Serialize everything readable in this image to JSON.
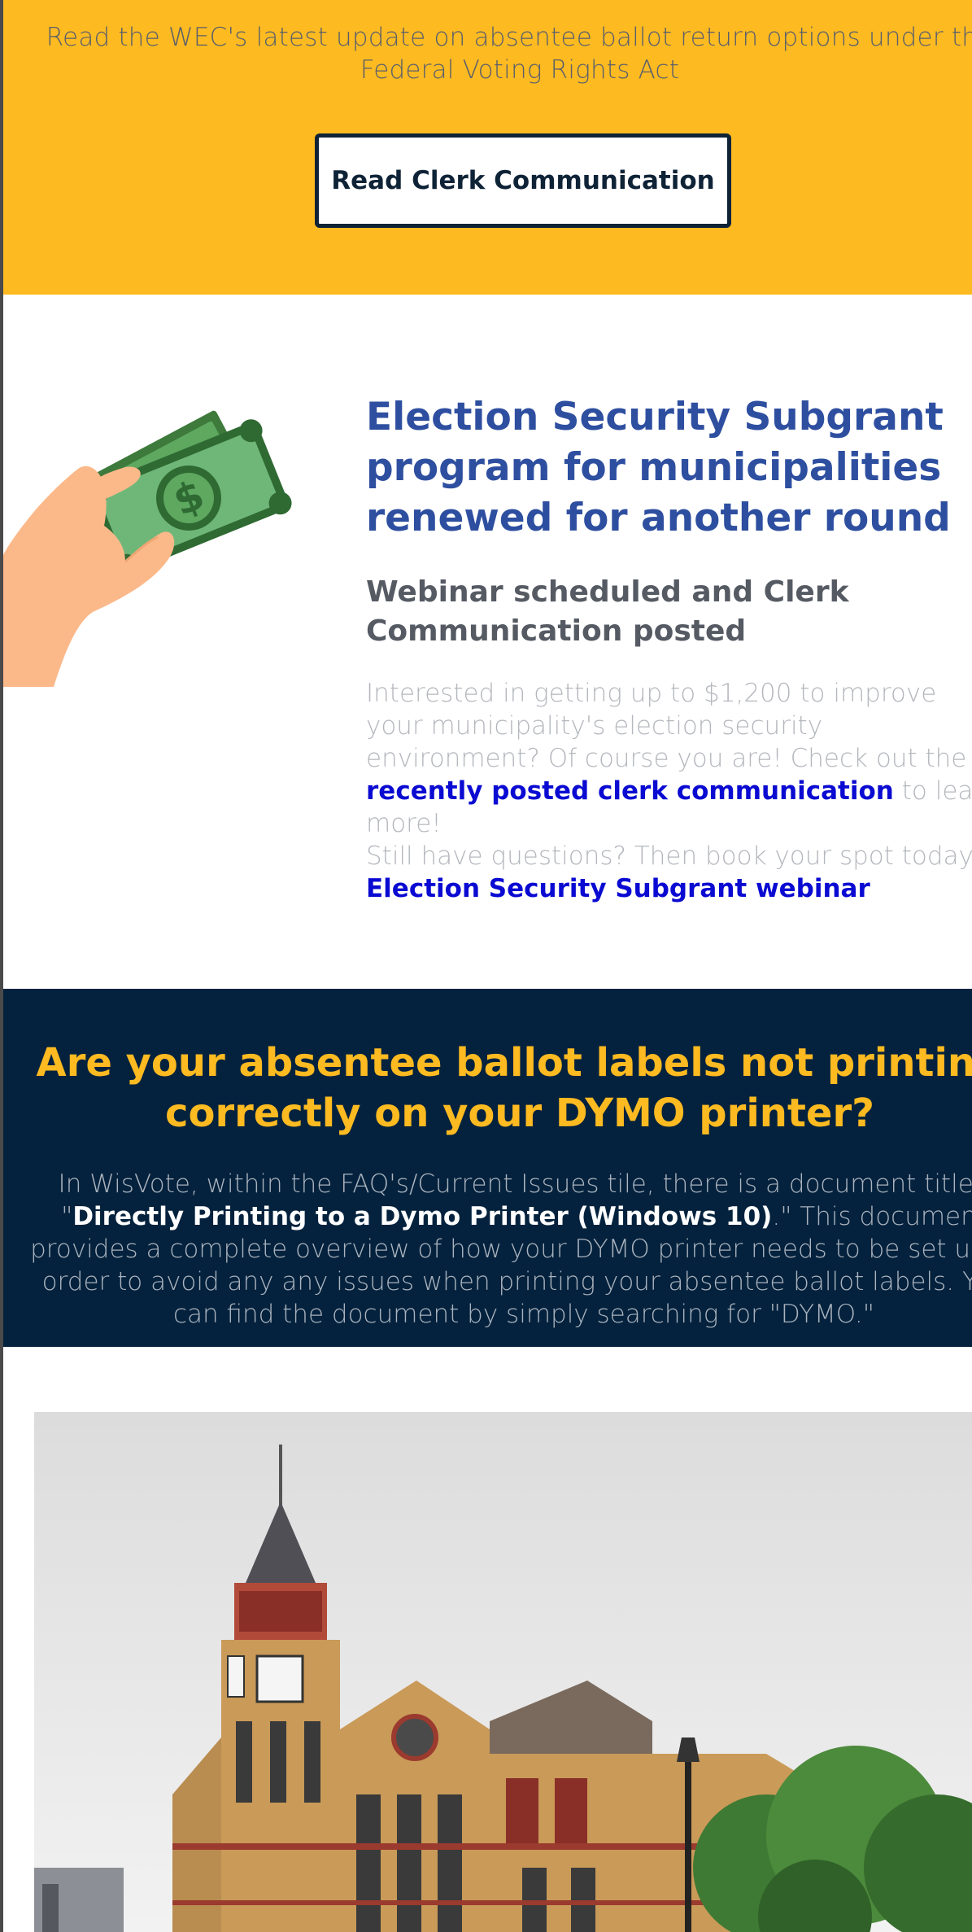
{
  "banner": {
    "text": "Read the WEC's latest update on absentee ballot return options under the Federal Voting Rights Act",
    "button_label": "Read Clerk Communication"
  },
  "subgrant": {
    "illustration_icon": "hand-holding-money-icon",
    "title": "Election Security Subgrant program for municipalities renewed for another round",
    "subtitle": "Webinar scheduled and Clerk Communication posted",
    "para1_before": "Interested in getting up to $1,200 to improve your municipality's election security environment? Of course you are! Check out the ",
    "para1_link": "recently posted clerk communication",
    "para1_after": " to learn more!",
    "para2_before": "Still have questions? Then book your spot today on the upcoming ",
    "para2_link": "Election Security Subgrant webinar"
  },
  "dymo": {
    "title": "Are your absentee ballot labels not printing correctly on your DYMO printer?",
    "text_before": "In WisVote, within the FAQ's/Current Issues tile, there is a document titled \"",
    "text_strong": "Directly Printing to a Dymo Printer (Windows 10)",
    "text_after": ".\" This document provides a complete overview of how your DYMO printer needs to be set up in order to avoid any any issues when printing your absentee ballot labels. You can find the document by simply searching for \"DYMO.\""
  },
  "photo": {
    "icon": "courthouse-photo"
  },
  "colors": {
    "banner_yellow": "#fdba21",
    "navy": "#04223d",
    "title_blue": "#2e4fa0",
    "link_blue": "#0a0ad2"
  }
}
